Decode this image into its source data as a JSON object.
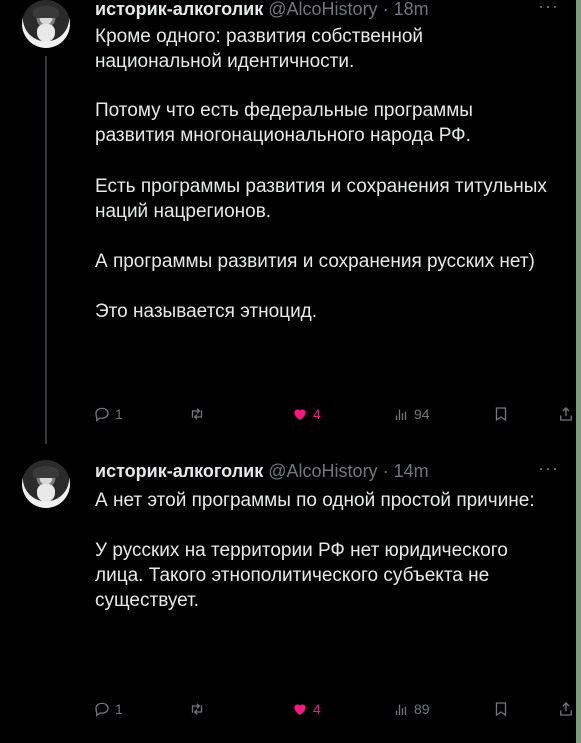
{
  "tweets": [
    {
      "name": "историк-алкоголик",
      "handle": "@AlcoHistory",
      "sep": "·",
      "time": "18m",
      "paragraphs": [
        "Кроме одного: развития собственной национальной идентичности.",
        "Потому что есть федеральные программы развития многонационального народа РФ.",
        "Есть программы развития и сохранения титульных наций нацрегионов.",
        "А программы развития и сохранения русских нет)",
        "Это называется этноцид."
      ],
      "replies": "1",
      "likes": "4",
      "views": "94"
    },
    {
      "name": "историк-алкоголик",
      "handle": "@AlcoHistory",
      "sep": "·",
      "time": "14m",
      "paragraphs": [
        "А нет этой программы по одной простой причине:",
        "У русских на территории РФ нет юридического лица. Такого этнополитического субъекта не существует."
      ],
      "replies": "1",
      "likes": "4",
      "views": "89"
    }
  ],
  "more_label": "···",
  "colors": {
    "like": "#f91880",
    "muted": "#71767b",
    "text": "#e7e9ea"
  },
  "icons": [
    "reply-icon",
    "retweet-icon",
    "heart-icon",
    "views-icon",
    "bookmark-icon",
    "share-icon"
  ]
}
